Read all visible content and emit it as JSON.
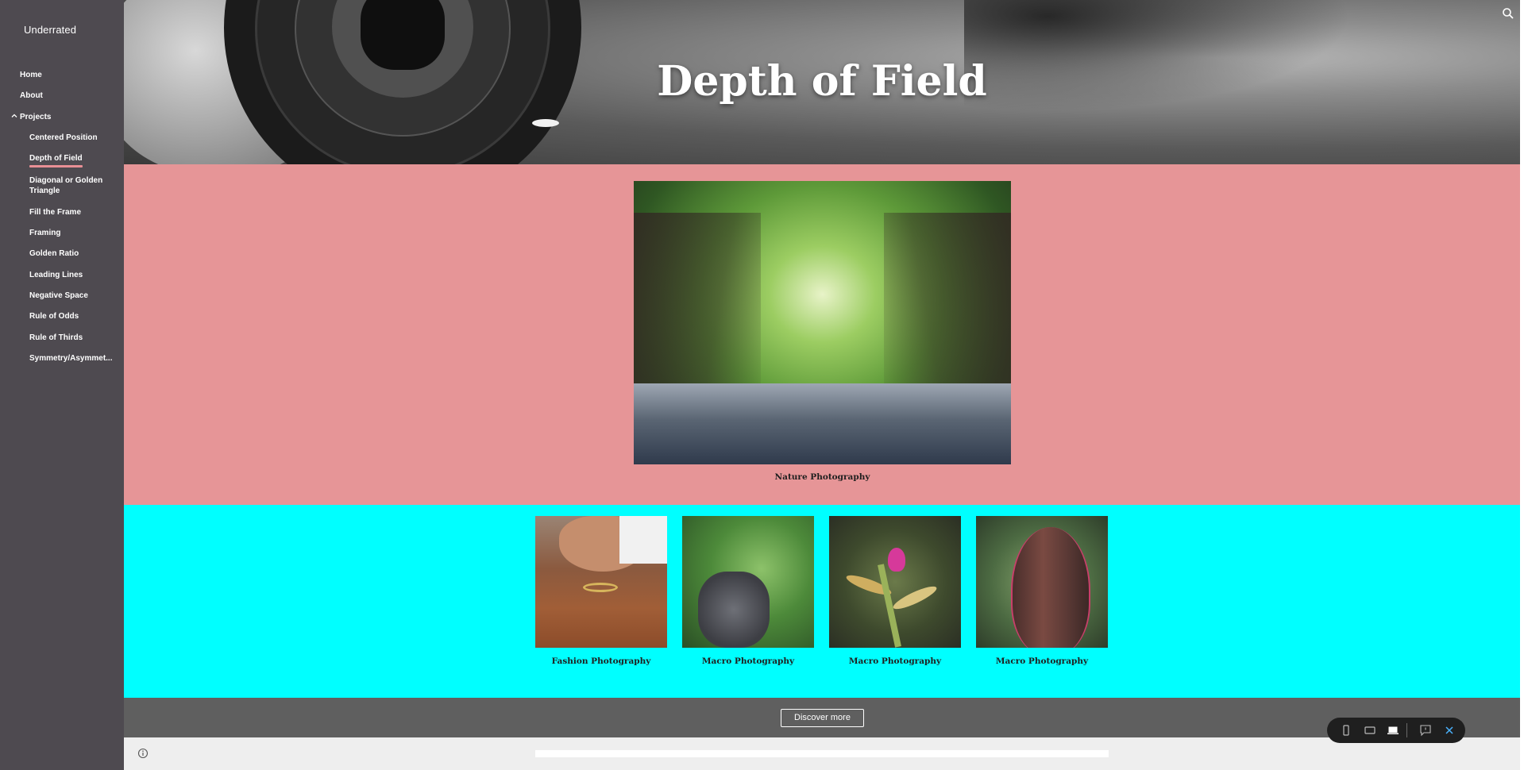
{
  "site": {
    "title": "Underrated"
  },
  "nav": {
    "home": "Home",
    "about": "About",
    "projects": "Projects",
    "items": [
      "Centered Position",
      "Depth of Field",
      "Diagonal or Golden Triangle",
      "Fill the Frame",
      "Framing",
      "Golden Ratio",
      "Leading Lines",
      "Negative Space",
      "Rule of Odds",
      "Rule of Thirds",
      "Symmetry/Asymmet..."
    ],
    "active": "Depth of Field"
  },
  "hero": {
    "title": "Depth of Field"
  },
  "main_image": {
    "caption": "Nature Photography"
  },
  "gallery": [
    {
      "caption": "Fashion Photography"
    },
    {
      "caption": "Macro Photography"
    },
    {
      "caption": "Macro Photography"
    },
    {
      "caption": "Macro Photography"
    }
  ],
  "footer": {
    "discover_label": "Discover more"
  },
  "colors": {
    "sidebar": "#4e4a50",
    "pink_section": "#e69597",
    "cyan_section": "#00ffff",
    "footer": "#5f5f5f",
    "active_underline": "#e98f95",
    "preview_close": "#4ab3ff"
  },
  "icons": {
    "search": "search-icon",
    "info": "info-icon",
    "chevron": "chevron-up-icon",
    "preview": [
      "phone-icon",
      "tablet-icon",
      "laptop-icon",
      "feedback-icon",
      "close-icon"
    ]
  }
}
